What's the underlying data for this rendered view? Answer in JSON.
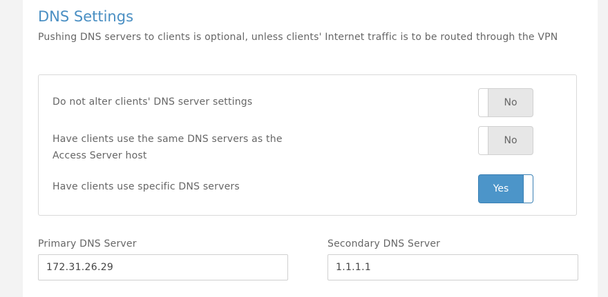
{
  "section": {
    "title": "DNS Settings",
    "description": "Pushing DNS servers to clients is optional, unless clients' Internet traffic is to be routed through the VPN"
  },
  "options": [
    {
      "label": "Do not alter clients' DNS server settings",
      "toggle_label": "No",
      "state": "off"
    },
    {
      "label_line1": "Have clients use the same DNS servers as the",
      "label_line2": "Access Server host",
      "toggle_label": "No",
      "state": "off"
    },
    {
      "label": "Have clients use specific DNS servers",
      "toggle_label": "Yes",
      "state": "on"
    }
  ],
  "fields": {
    "primary": {
      "label": "Primary DNS Server",
      "value": "172.31.26.29"
    },
    "secondary": {
      "label": "Secondary DNS Server",
      "value": "1.1.1.1"
    }
  },
  "colors": {
    "accent": "#4c95c9",
    "title": "#4a8fc3"
  }
}
